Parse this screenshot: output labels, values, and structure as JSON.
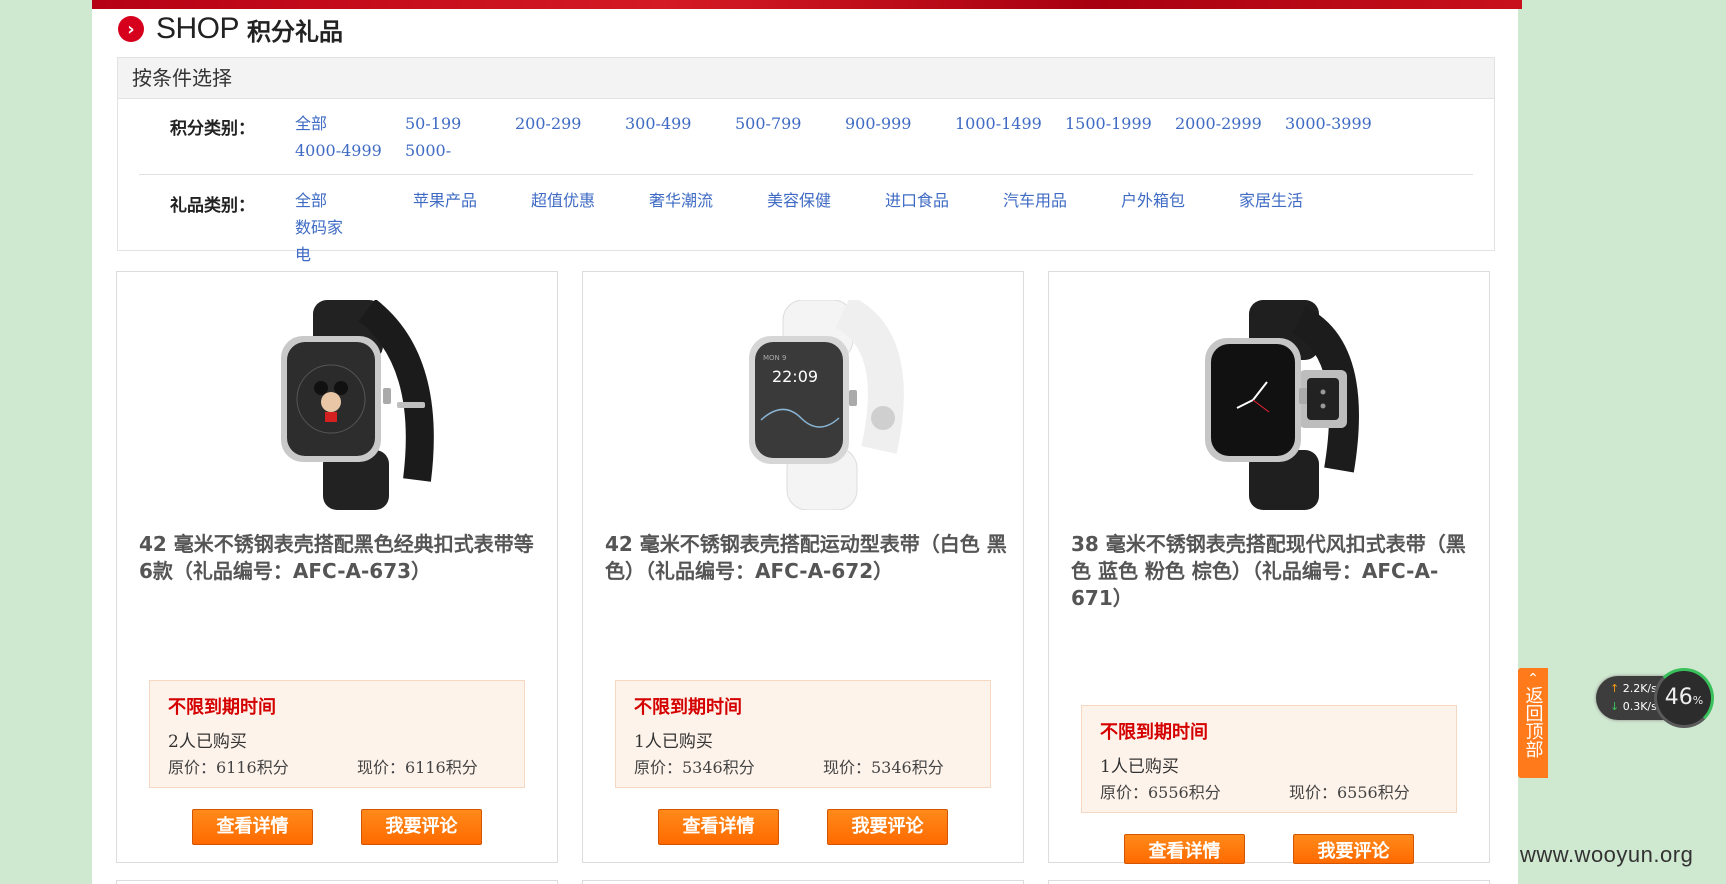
{
  "header": {
    "shop_icon_glyph": "›",
    "title": "SHOP",
    "subtitle": "积分礼品"
  },
  "filter": {
    "heading": "按条件选择",
    "points_label": "积分类别：",
    "points_options": [
      "全部",
      "50-199",
      "200-299",
      "300-499",
      "500-799",
      "900-999",
      "1000-1499",
      "1500-1999",
      "2000-2999",
      "3000-3999",
      "4000-4999",
      "5000-"
    ],
    "gift_label": "礼品类别：",
    "gift_options": [
      "全部",
      "苹果产品",
      "超值优惠",
      "奢华潮流",
      "美容保健",
      "进口食品",
      "汽车用品",
      "户外箱包",
      "家居生活",
      "数码家电"
    ]
  },
  "products": [
    {
      "image": "black-classic-buckle-watch",
      "title": "42 毫米不锈钢表壳搭配黑色经典扣式表带等6款（礼品编号：AFC-A-673）",
      "expiry": "不限到期时间",
      "buyers": "2人已购买",
      "original_price": "原价：6116积分",
      "current_price": "现价：6116积分",
      "detail_button": "查看详情",
      "review_button": "我要评论"
    },
    {
      "image": "white-sport-band-watch",
      "title": "42 毫米不锈钢表壳搭配运动型表带（白色 黑色）（礼品编号：AFC-A-672）",
      "expiry": "不限到期时间",
      "buyers": "1人已购买",
      "original_price": "原价：5346积分",
      "current_price": "现价：5346积分",
      "detail_button": "查看详情",
      "review_button": "我要评论"
    },
    {
      "image": "black-modern-buckle-watch",
      "title": "38 毫米不锈钢表壳搭配现代风扣式表带（黑色 蓝色 粉色 棕色）（礼品编号：AFC-A-671）",
      "expiry": "不限到期时间",
      "buyers": "1人已购买",
      "original_price": "原价：6556积分",
      "current_price": "现价：6556积分",
      "detail_button": "查看详情",
      "review_button": "我要评论"
    }
  ],
  "back_to_top": {
    "arrow": "⌃",
    "label": "返回顶部"
  },
  "speed_widget": {
    "upload": "2.2K/s",
    "download": "0.3K/s",
    "percent": "46",
    "percent_unit": "%"
  },
  "watermark": "www.wooyun.org",
  "colors": {
    "accent_red": "#d6001c",
    "link_blue": "#3f6bc4",
    "button_orange": "#ff7a1a",
    "expiry_red": "#d40000",
    "page_background": "#cfe8d0"
  }
}
